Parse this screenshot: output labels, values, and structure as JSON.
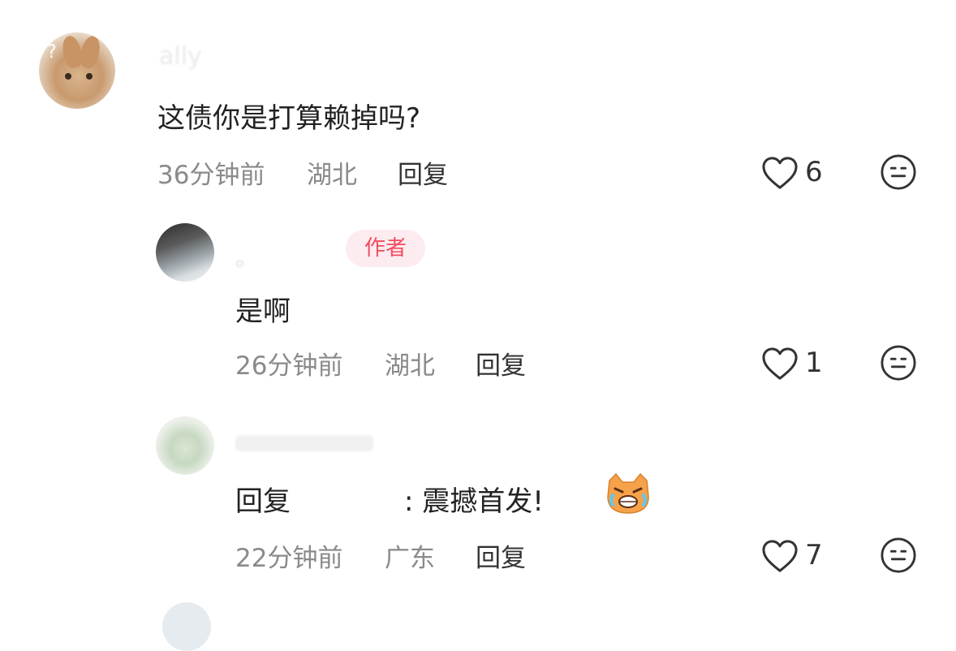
{
  "comments": [
    {
      "username": "ally",
      "text": "这债你是打算赖掉吗?",
      "time": "36分钟前",
      "location": "湖北",
      "reply_label": "回复",
      "likes": "6"
    },
    {
      "username": "。",
      "badge": "作者",
      "text": "是啊",
      "time": "26分钟前",
      "location": "湖北",
      "reply_label": "回复",
      "likes": "1"
    },
    {
      "username": "",
      "text_prefix": "回复",
      "text_suffix": ": 震撼首发!",
      "time": "22分钟前",
      "location": "广东",
      "reply_label": "回复",
      "likes": "7"
    }
  ],
  "colors": {
    "badge_bg": "#fdecef",
    "badge_text": "#f24c5f",
    "meta_text": "#8a8a8a",
    "body_text": "#222222"
  },
  "icons": {
    "like": "heart-outline-icon",
    "dislike": "neutral-face-icon",
    "emoji": "crying-angry-cat-emoji"
  }
}
